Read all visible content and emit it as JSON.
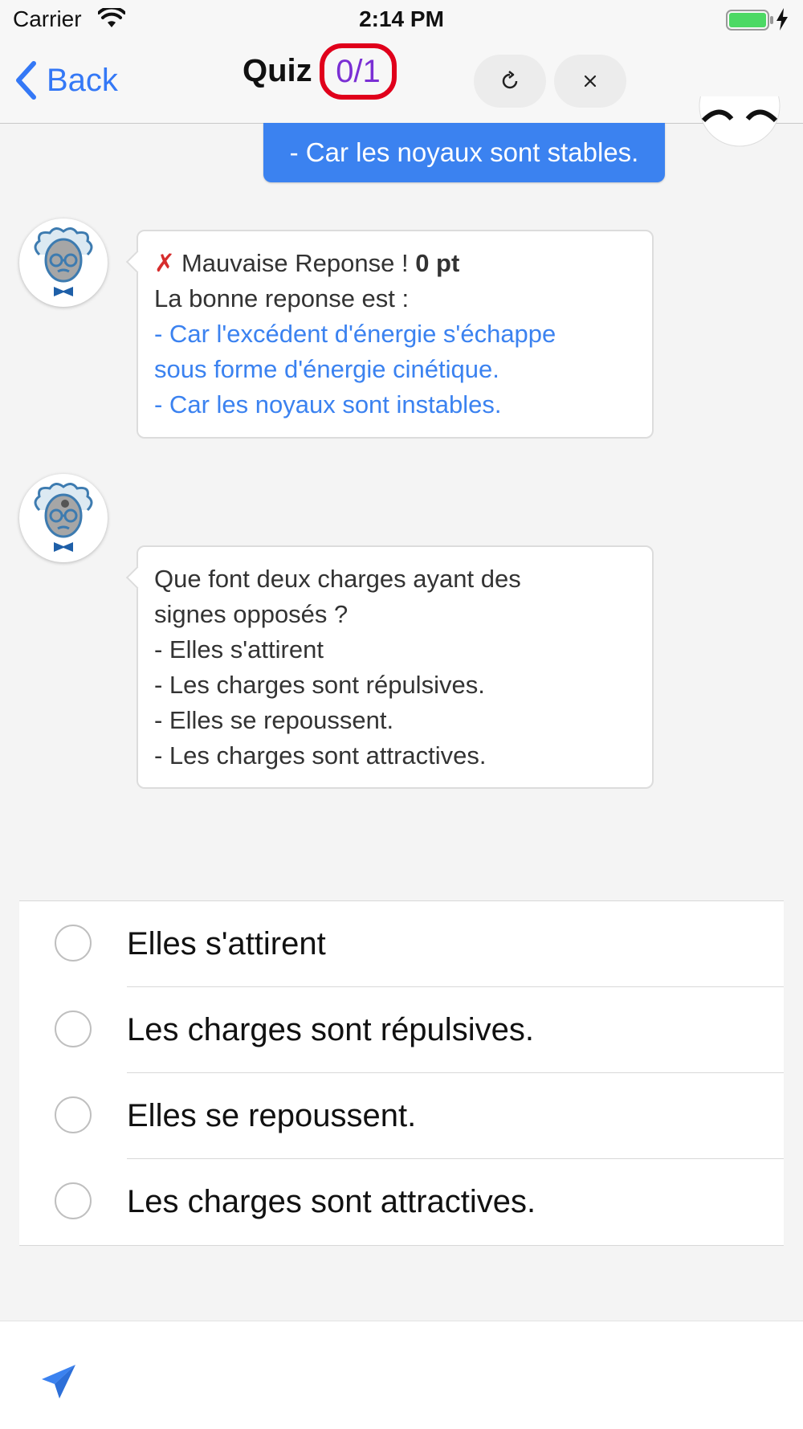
{
  "status_bar": {
    "carrier": "Carrier",
    "time": "2:14 PM"
  },
  "nav": {
    "back_label": "Back",
    "title": "Quiz",
    "score": "0/1",
    "colors": {
      "accent": "#3478f6",
      "score_text": "#7a2fd4",
      "score_ring": "#e0001b"
    }
  },
  "chat": {
    "user_message": "- Car les noyaux sont stables.",
    "feedback": {
      "icon": "cross-mark-icon",
      "verdict": "Mauvaise Reponse ! ",
      "points": "0 pt",
      "intro": "La bonne reponse est :",
      "correct_lines": [
        "- Car l'excédent d'énergie s'échappe",
        "sous forme d'énergie cinétique.",
        "- Car les noyaux sont instables."
      ]
    },
    "question": {
      "lines": [
        "Que font deux charges ayant des",
        "signes opposés ?",
        "- Elles s'attirent",
        "- Les charges sont répulsives.",
        "- Elles se repoussent.",
        "- Les charges sont attractives."
      ]
    }
  },
  "options": [
    {
      "label": "Elles s'attirent"
    },
    {
      "label": "Les charges sont répulsives."
    },
    {
      "label": "Elles se repoussent."
    },
    {
      "label": "Les charges sont attractives."
    }
  ],
  "bottom_bar": {
    "send_icon": "send-icon"
  }
}
